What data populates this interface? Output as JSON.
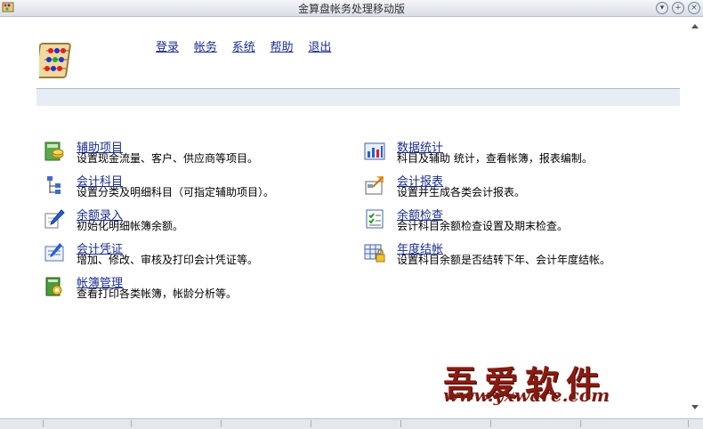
{
  "window": {
    "title": "金算盘帐务处理移动版"
  },
  "menu": [
    "登录",
    "帐务",
    "系统",
    "帮助",
    "退出"
  ],
  "left_items": [
    {
      "label": "辅助项目",
      "desc": "设置现金流量、客户、供应商等项目。",
      "icon": "ledger-coins-icon"
    },
    {
      "label": "会计科目",
      "desc": "设置分类及明细科目（可指定辅助项目）。",
      "icon": "tree-icon"
    },
    {
      "label": "余额录入",
      "desc": "初始化明细帐簿余额。",
      "icon": "pen-icon"
    },
    {
      "label": "会计凭证",
      "desc": "增加、修改、审核及打印会计凭证等。",
      "icon": "voucher-icon"
    },
    {
      "label": "帐簿管理",
      "desc": "查看打印各类帐簿，帐龄分析等。",
      "icon": "book-gear-icon"
    }
  ],
  "right_items": [
    {
      "label": "数据统计",
      "desc": "科目及辅助 统计，查看帐簿，报表编制。",
      "icon": "bar-chart-icon"
    },
    {
      "label": "会计报表",
      "desc": "设置并生成各类会计报表。",
      "icon": "report-icon"
    },
    {
      "label": "余额检查",
      "desc": "会计科目余额检查设置及期末检查。",
      "icon": "checklist-icon"
    },
    {
      "label": "年度结帐",
      "desc": "设置科目余额是否结转下年、会计年度结帐。",
      "icon": "lock-table-icon"
    }
  ],
  "watermark": {
    "cn": "吾爱软件",
    "url": "www.yxware.com"
  },
  "colors": {
    "link": "#1a2d8f",
    "band": "#e7ecf5",
    "watermark": "#8b1a10"
  }
}
